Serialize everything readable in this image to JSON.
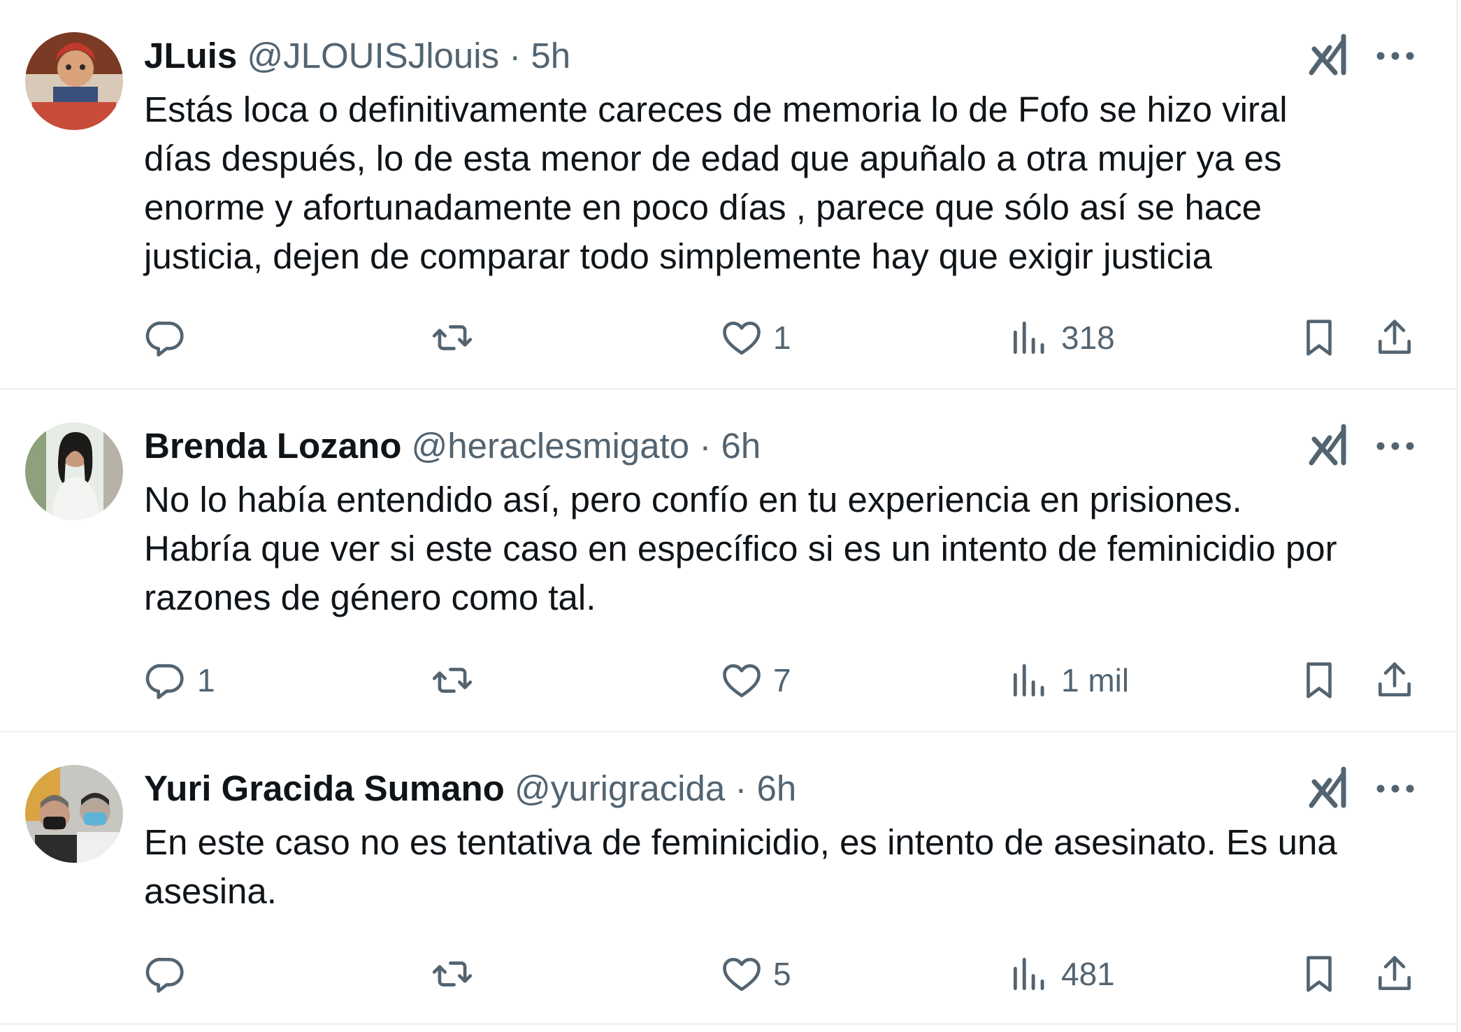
{
  "tweets": [
    {
      "name": "JLuis",
      "handle": "@JLOUISJlouis",
      "separator": "·",
      "time": "5h",
      "text": "Estás loca o definitivamente careces de memoria lo de Fofo se hizo viral\ndías después, lo de esta menor de edad que apuñalo a otra mujer ya es\nenorme y afortunadamente en poco días , parece que sólo así se hace\njusticia, dejen de comparar todo simplemente hay que exigir justicia",
      "replies": "",
      "reposts": "",
      "likes": "1",
      "views": "318",
      "avatar_colors": [
        "#6b2c1c",
        "#d9a27a",
        "#3a4f7a",
        "#c94b3a"
      ]
    },
    {
      "name": "Brenda Lozano",
      "handle": "@heraclesmigato",
      "separator": "·",
      "time": "6h",
      "text": "No lo había entendido así, pero confío en tu experiencia en prisiones.\nHabría que ver si este caso en específico si es un intento de feminicidio por\nrazones de género como tal.",
      "replies": "1",
      "reposts": "",
      "likes": "7",
      "views": "1 mil",
      "avatar_colors": [
        "#e8ece6",
        "#1d1b1a",
        "#f4f4f2",
        "#8da17c"
      ]
    },
    {
      "name": "Yuri Gracida Sumano",
      "handle": "@yurigracida",
      "separator": "·",
      "time": "6h",
      "text": "En este caso no es tentativa de feminicidio, es intento de asesinato. Es una\nasesina.",
      "replies": "",
      "reposts": "",
      "likes": "5",
      "views": "481",
      "avatar_colors": [
        "#d9a441",
        "#1b1b1b",
        "#5bb4d8",
        "#c8c6c0"
      ]
    }
  ],
  "icons": {
    "grok": "grok-icon",
    "more": "more-icon",
    "reply": "reply-icon",
    "repost": "repost-icon",
    "like": "heart-icon",
    "views": "views-icon",
    "bookmark": "bookmark-icon",
    "share": "share-icon"
  },
  "colors": {
    "text": "#0f1419",
    "secondary": "#536471",
    "divider": "#eff3f4"
  }
}
